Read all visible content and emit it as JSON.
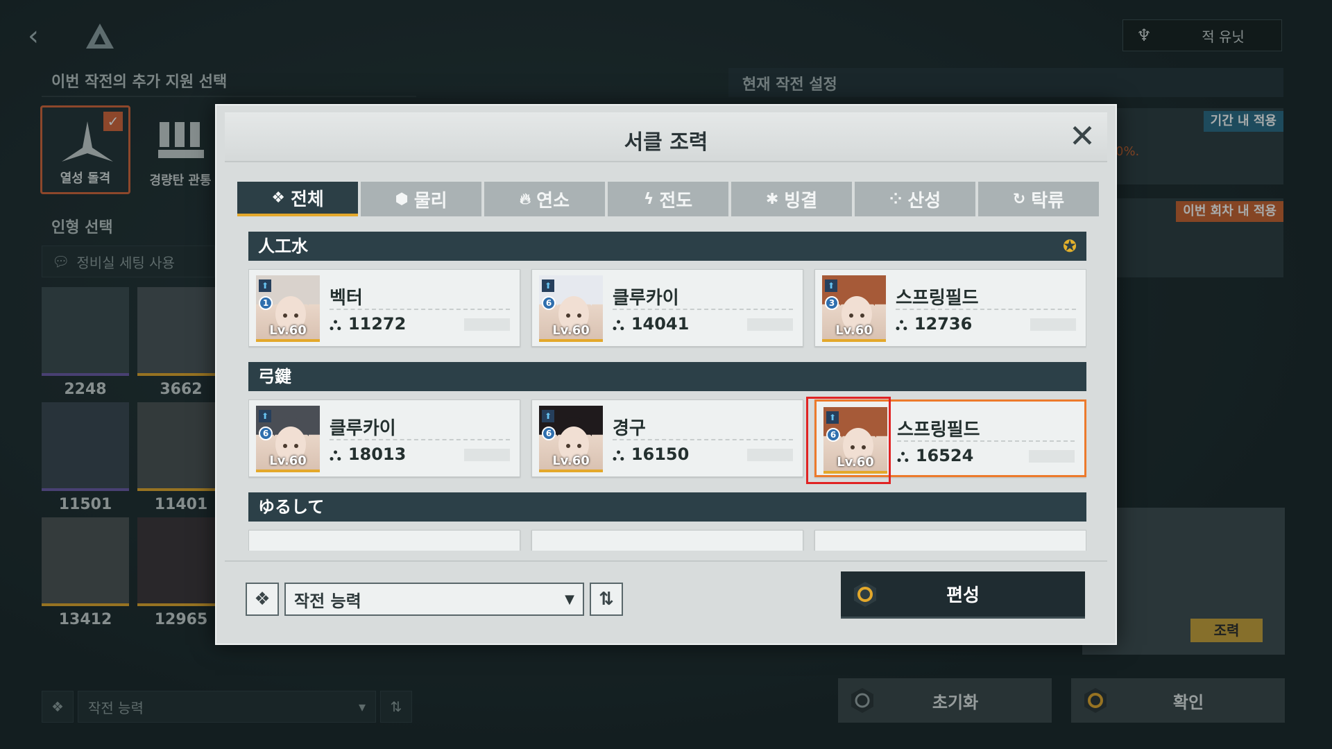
{
  "background": {
    "enemy_units_label": "적 유닛",
    "extra_support_title": "이번 작전의 추가 지원 선택",
    "support_cards": [
      {
        "label": "열성 돌격"
      },
      {
        "label": "경량탄 관통"
      }
    ],
    "formation_title": "인형 선택",
    "preset_label": "정비실 세팅 사용",
    "unit_powers": [
      "2248",
      "3662",
      "11501",
      "11401",
      "13412",
      "12965"
    ],
    "sort_label": "작전 능력",
    "current_settings_title": "현재 작전 설정",
    "tag_period": "기간 내 적용",
    "tag_round": "이번 회차 내 적용",
    "percent_hint": "0%.",
    "coop_tag": "조력",
    "reset_label": "초기화",
    "confirm_label": "확인"
  },
  "modal": {
    "title": "서클 조력",
    "tabs": [
      {
        "glyph": "❖",
        "label": "전체"
      },
      {
        "glyph": "⬢",
        "label": "물리"
      },
      {
        "glyph": "🔥︎",
        "label": "연소"
      },
      {
        "glyph": "ϟ",
        "label": "전도"
      },
      {
        "glyph": "✱",
        "label": "빙결"
      },
      {
        "glyph": "⁘",
        "label": "산성"
      },
      {
        "glyph": "↻",
        "label": "탁류"
      }
    ],
    "groups": [
      {
        "name": "人工水",
        "cards": [
          {
            "name": "벡터",
            "level": "Lv.60",
            "rank": "1",
            "power": "11272",
            "hair": "#d9d2cc"
          },
          {
            "name": "클루카이",
            "level": "Lv.60",
            "rank": "6",
            "power": "14041",
            "hair": "#e6e9ef"
          },
          {
            "name": "스프링필드",
            "level": "Lv.60",
            "rank": "3",
            "power": "12736",
            "hair": "#a65a38"
          }
        ]
      },
      {
        "name": "弓鍵",
        "cards": [
          {
            "name": "클루카이",
            "level": "Lv.60",
            "rank": "6",
            "power": "18013",
            "hair": "#4a4e55"
          },
          {
            "name": "경구",
            "level": "Lv.60",
            "rank": "6",
            "power": "16150",
            "hair": "#1f1a1c"
          },
          {
            "name": "스프링필드",
            "level": "Lv.60",
            "rank": "6",
            "power": "16524",
            "hair": "#a65a38"
          }
        ]
      },
      {
        "name": "ゆるして",
        "cards": []
      }
    ],
    "sort_label": "작전 능력",
    "formation_button": "편성"
  },
  "colors": {
    "accent_orange": "#ec7a2c",
    "highlight_red": "#e02323",
    "tab_active": "#2c3f46",
    "gold": "#e3a82b"
  }
}
